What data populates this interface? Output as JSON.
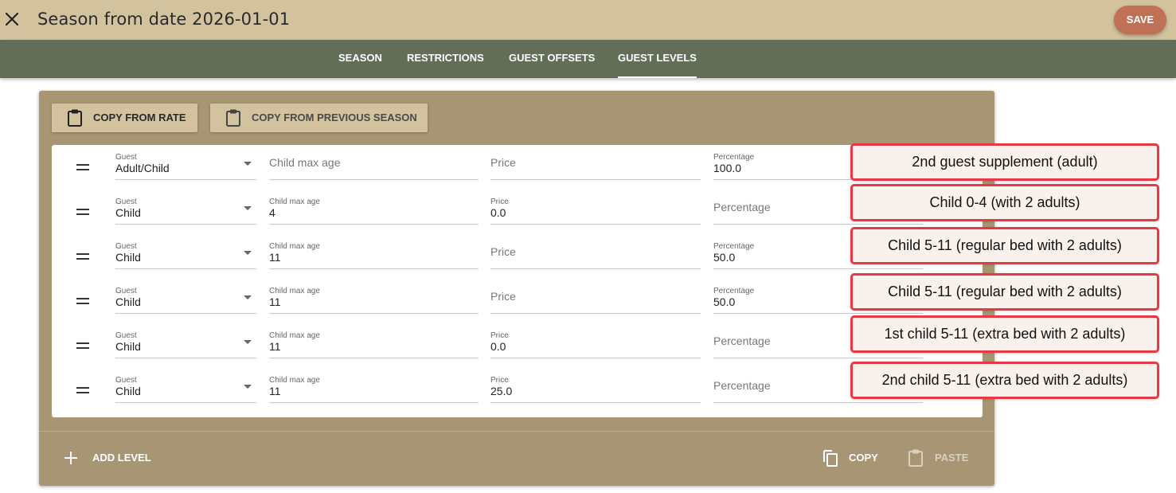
{
  "header": {
    "title": "Season from date 2026-01-01",
    "save_label": "SAVE",
    "close_icon": "close-icon",
    "accent_color": "#d3c29e",
    "save_color": "#c07055"
  },
  "tabs": [
    {
      "label": "SEASON",
      "active": false
    },
    {
      "label": "RESTRICTIONS",
      "active": false
    },
    {
      "label": "GUEST OFFSETS",
      "active": false
    },
    {
      "label": "GUEST LEVELS",
      "active": true
    }
  ],
  "toolbar": {
    "copy_from_rate": "COPY FROM RATE",
    "copy_from_previous_season": "COPY FROM PREVIOUS SEASON",
    "icon": "clipboard-icon"
  },
  "levels": [
    {
      "guest_label": "Guest",
      "guest": "Adult/Child",
      "age_label": "Child max age",
      "age": "",
      "price_label": "Price",
      "price": "",
      "pct_label": "Percentage",
      "pct": "100.0"
    },
    {
      "guest_label": "Guest",
      "guest": "Child",
      "age_label": "Child max age",
      "age": "4",
      "price_label": "Price",
      "price": "0.0",
      "pct_label": "Percentage",
      "pct": ""
    },
    {
      "guest_label": "Guest",
      "guest": "Child",
      "age_label": "Child max age",
      "age": "11",
      "price_label": "Price",
      "price": "",
      "pct_label": "Percentage",
      "pct": "50.0"
    },
    {
      "guest_label": "Guest",
      "guest": "Child",
      "age_label": "Child max age",
      "age": "11",
      "price_label": "Price",
      "price": "",
      "pct_label": "Percentage",
      "pct": "50.0"
    },
    {
      "guest_label": "Guest",
      "guest": "Child",
      "age_label": "Child max age",
      "age": "11",
      "price_label": "Price",
      "price": "0.0",
      "pct_label": "Percentage",
      "pct": ""
    },
    {
      "guest_label": "Guest",
      "guest": "Child",
      "age_label": "Child max age",
      "age": "11",
      "price_label": "Price",
      "price": "25.0",
      "pct_label": "Percentage",
      "pct": ""
    }
  ],
  "footer": {
    "add_level": "ADD LEVEL",
    "copy": "COPY",
    "paste": "PASTE"
  },
  "annotations": [
    "2nd guest supplement (adult)",
    "Child 0-4 (with 2 adults)",
    "Child 5-11 (regular bed with 2 adults)",
    "Child 5-11 (regular bed with 2 adults)",
    "1st child 5-11 (extra bed with 2 adults)",
    "2nd child 5-11 (extra bed with 2 adults)"
  ]
}
